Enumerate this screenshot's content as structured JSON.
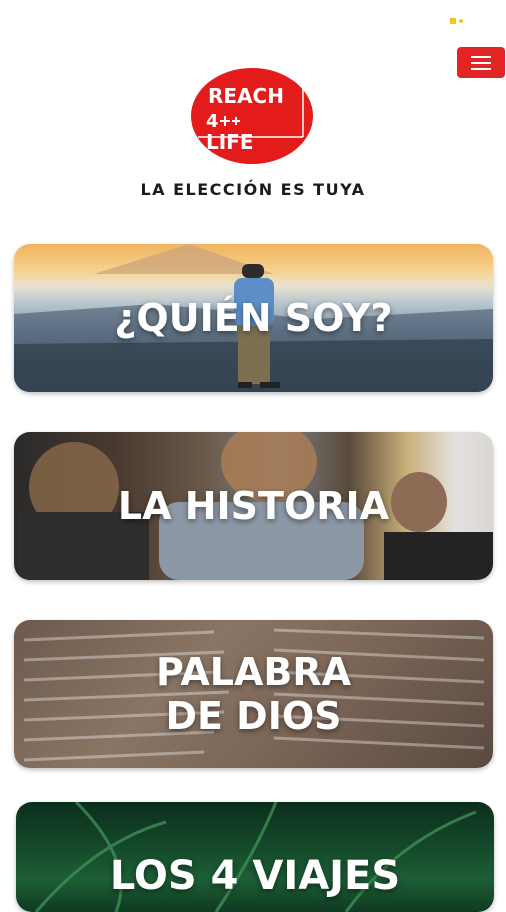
{
  "header": {
    "logo": {
      "line1": "REACH",
      "line2": "4",
      "line3": "LIFE",
      "color": "#e31b1b"
    },
    "tagline": "LA ELECCIÓN ES TUYA",
    "menu_icon": "hamburger-menu-icon",
    "menu_color": "#e32424"
  },
  "cards": [
    {
      "title": "¿QUIÉN SOY?",
      "image": "man-on-mountain-sunset"
    },
    {
      "title": "LA HISTORIA",
      "image": "friends-talking-outdoors"
    },
    {
      "title": "PALABRA\nDE DIOS",
      "image": "open-bible-page"
    },
    {
      "title": "LOS 4 VIAJES",
      "image": "green-ferns"
    }
  ]
}
